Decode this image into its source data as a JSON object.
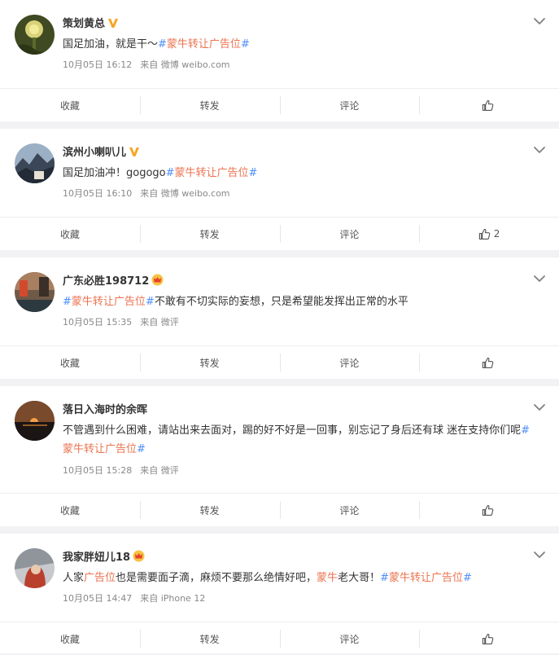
{
  "actions": {
    "collect": "收藏",
    "repost": "转发",
    "comment": "评论"
  },
  "posts": [
    {
      "username": "策划黄总",
      "badge": "v-badge",
      "segments": [
        {
          "t": "国足加油，就是干～",
          "c": ""
        },
        {
          "t": "#",
          "c": "hash"
        },
        {
          "t": "蒙牛转让广告位",
          "c": "tag"
        },
        {
          "t": "#",
          "c": "hash"
        }
      ],
      "date": "10月05日 16:12",
      "source": "来自 微博 weibo.com",
      "likes": ""
    },
    {
      "username": "滨州小喇叭儿",
      "badge": "v-badge",
      "segments": [
        {
          "t": "国足加油冲！gogogo",
          "c": ""
        },
        {
          "t": "#",
          "c": "hash"
        },
        {
          "t": "蒙牛转让广告位",
          "c": "tag"
        },
        {
          "t": "#",
          "c": "hash"
        }
      ],
      "date": "10月05日 16:10",
      "source": "来自 微博 weibo.com",
      "likes": "2"
    },
    {
      "username": "广东必胜198712",
      "badge": "crown-badge",
      "segments": [
        {
          "t": "#",
          "c": "hash"
        },
        {
          "t": "蒙牛转让广告位",
          "c": "tag"
        },
        {
          "t": "#",
          "c": "hash"
        },
        {
          "t": "不敢有不切实际的妄想，只是希望能发挥出正常的水平",
          "c": ""
        }
      ],
      "date": "10月05日 15:35",
      "source": "来自 微评",
      "likes": ""
    },
    {
      "username": "落日入海时的余晖",
      "badge": "",
      "segments": [
        {
          "t": "不管遇到什么困难，请站出来去面对，踢的好不好是一回事，别忘记了身后还有球 迷在支持你们呢",
          "c": ""
        },
        {
          "t": "#",
          "c": "hash"
        },
        {
          "t": "蒙牛转让广告位",
          "c": "tag"
        },
        {
          "t": "#",
          "c": "hash"
        }
      ],
      "date": "10月05日 15:28",
      "source": "来自 微评",
      "likes": ""
    },
    {
      "username": "我家胖妞儿18",
      "badge": "crown-badge",
      "segments": [
        {
          "t": "人家",
          "c": ""
        },
        {
          "t": "广告位",
          "c": "hl"
        },
        {
          "t": "也是需要面子滴，麻烦不要那么绝情好吧，",
          "c": ""
        },
        {
          "t": "蒙牛",
          "c": "hl"
        },
        {
          "t": "老大哥！",
          "c": ""
        },
        {
          "t": "#",
          "c": "hash"
        },
        {
          "t": "蒙牛转让广告位",
          "c": "tag"
        },
        {
          "t": "#",
          "c": "hash"
        }
      ],
      "date": "10月05日 14:47",
      "source": "来自 iPhone 12",
      "likes": ""
    }
  ]
}
